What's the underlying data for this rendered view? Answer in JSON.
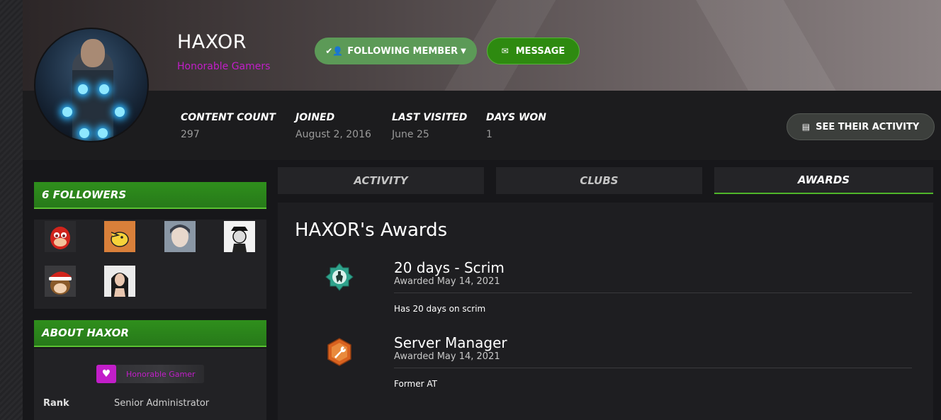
{
  "profile": {
    "username": "HAXOR",
    "group": "Honorable Gamers",
    "follow_button": "FOLLOWING MEMBER",
    "message_button": "MESSAGE",
    "activity_button": "SEE THEIR ACTIVITY"
  },
  "stats": [
    {
      "label": "CONTENT COUNT",
      "value": "297"
    },
    {
      "label": "JOINED",
      "value": "August 2, 2016"
    },
    {
      "label": "LAST VISITED",
      "value": "June 25"
    },
    {
      "label": "DAYS WON",
      "value": "1"
    }
  ],
  "followers": {
    "title": "6 FOLLOWERS",
    "count": 6
  },
  "about": {
    "title": "ABOUT HAXOR",
    "badge": "Honorable Gamer",
    "rank_label": "Rank",
    "rank_value": "Senior Administrator"
  },
  "tabs": [
    {
      "label": "ACTIVITY",
      "active": false
    },
    {
      "label": "CLUBS",
      "active": false
    },
    {
      "label": "AWARDS",
      "active": true
    }
  ],
  "awards": {
    "title": "HAXOR's Awards",
    "items": [
      {
        "name": "20 days - Scrim",
        "date": "Awarded May 14, 2021",
        "description": "Has 20 days on scrim",
        "icon": "scrim-badge-icon"
      },
      {
        "name": "Server Manager",
        "date": "Awarded May 14, 2021",
        "description": "Former AT",
        "icon": "wrench-badge-icon"
      }
    ]
  },
  "colors": {
    "accent_green": "#2e8a10",
    "group_purple": "#c21ec9",
    "background": "#17171a"
  }
}
